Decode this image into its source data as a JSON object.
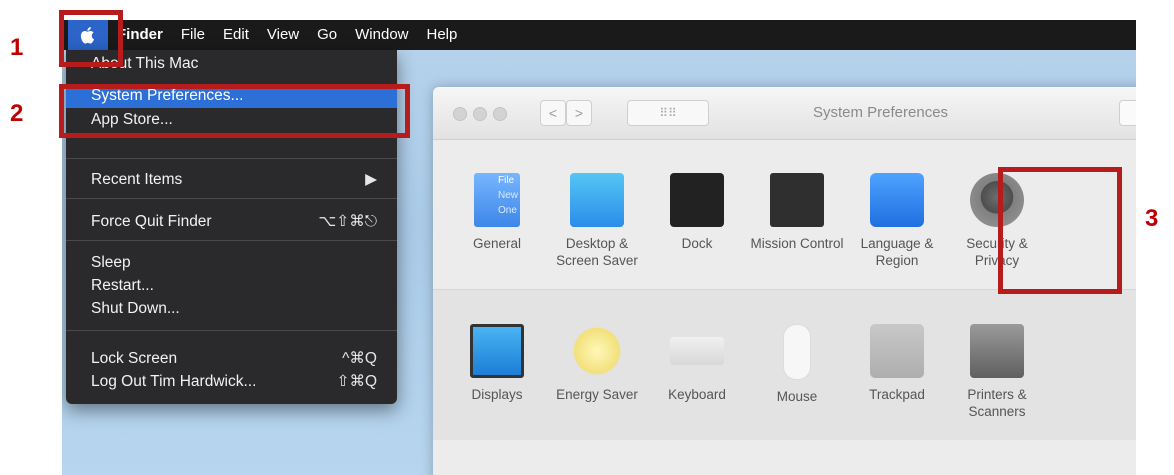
{
  "menubar": {
    "apple_icon": "apple-logo",
    "items": [
      "Finder",
      "File",
      "Edit",
      "View",
      "Go",
      "Window",
      "Help"
    ]
  },
  "apple_menu": {
    "items": [
      {
        "label": "About This Mac",
        "shortcut": ""
      },
      {
        "label": "System Preferences...",
        "shortcut": "",
        "selected": true
      },
      {
        "label": "App Store...",
        "shortcut": ""
      },
      {
        "label": "Recent Items",
        "shortcut": "▶"
      },
      {
        "label": "Force Quit Finder",
        "shortcut": "⌥⇧⌘⎋"
      },
      {
        "label": "Sleep",
        "shortcut": ""
      },
      {
        "label": "Restart...",
        "shortcut": ""
      },
      {
        "label": "Shut Down...",
        "shortcut": ""
      },
      {
        "label": "Lock Screen",
        "shortcut": "^⌘Q"
      },
      {
        "label": "Log Out Tim Hardwick...",
        "shortcut": "⇧⌘Q"
      }
    ]
  },
  "window": {
    "title": "System Preferences",
    "back": "<",
    "forward": ">",
    "grid": "⠿⠿",
    "row1": [
      {
        "label": "General"
      },
      {
        "label": "Desktop & Screen Saver"
      },
      {
        "label": "Dock"
      },
      {
        "label": "Mission Control"
      },
      {
        "label": "Language & Region"
      },
      {
        "label": "Security & Privacy"
      }
    ],
    "row2": [
      {
        "label": "Displays"
      },
      {
        "label": "Energy Saver"
      },
      {
        "label": "Keyboard"
      },
      {
        "label": "Mouse"
      },
      {
        "label": "Trackpad"
      },
      {
        "label": "Printers & Scanners"
      }
    ],
    "general_icon_text": [
      "File",
      "New",
      "One"
    ]
  },
  "annotations": {
    "step1": "1",
    "step2": "2",
    "step3": "3"
  },
  "colors": {
    "menubar": "#1a1a1a",
    "menu_highlight": "#2c6fd6",
    "annotation_red": "#b71c1c"
  }
}
